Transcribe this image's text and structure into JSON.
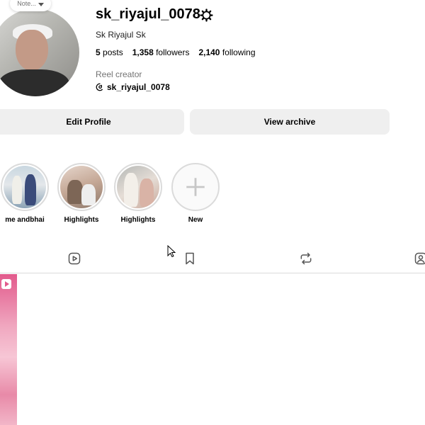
{
  "profile": {
    "note_label": "Note...",
    "username": "sk_riyajul_0078",
    "full_name": "Sk Riyajul Sk",
    "stats": {
      "posts_count": "5",
      "posts_label": "posts",
      "followers_count": "1,358",
      "followers_label": "followers",
      "following_count": "2,140",
      "following_label": "following"
    },
    "category": "Reel creator",
    "threads_handle": "sk_riyajul_0078"
  },
  "buttons": {
    "edit_profile": "Edit Profile",
    "view_archive": "View archive"
  },
  "highlights": [
    {
      "label": "me andbhai"
    },
    {
      "label": "Highlights"
    },
    {
      "label": "Highlights"
    },
    {
      "label": "New"
    }
  ],
  "tabs": [
    {
      "icon": "reels-icon"
    },
    {
      "icon": "saved-icon"
    },
    {
      "icon": "reposts-icon"
    },
    {
      "icon": "tagged-icon"
    }
  ],
  "colors": {
    "button_bg": "#efefef",
    "divider": "#dbdbdb",
    "secondary_text": "#737373"
  }
}
